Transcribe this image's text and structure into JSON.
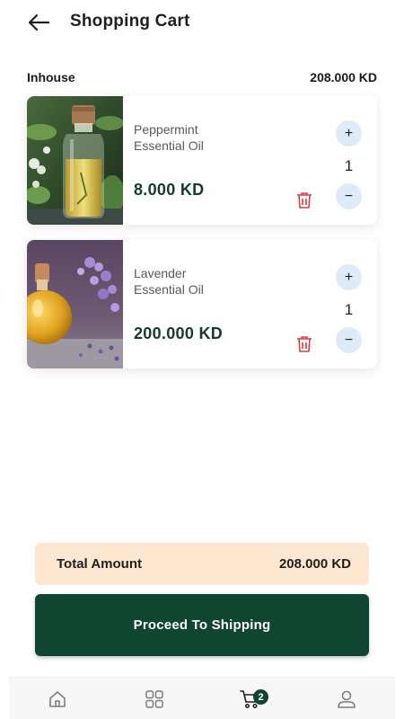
{
  "header": {
    "title": "Shopping Cart",
    "back_icon": "arrow-left-icon"
  },
  "section": {
    "label": "Inhouse",
    "total": "208.000 KD"
  },
  "items": [
    {
      "name_line1": "Peppermint",
      "name_line2": "Essential Oil",
      "price": "8.000 KD",
      "quantity": "1",
      "plus": "+",
      "minus": "−",
      "image": "peppermint-oil-bottle"
    },
    {
      "name_line1": "Lavender",
      "name_line2": "Essential Oil",
      "price": "200.000 KD",
      "quantity": "1",
      "plus": "+",
      "minus": "−",
      "image": "lavender-oil-flask"
    }
  ],
  "summary": {
    "label": "Total Amount",
    "value": "208.000 KD"
  },
  "proceed": {
    "label": "Proceed To Shipping"
  },
  "nav": {
    "items": [
      {
        "icon": "home-icon"
      },
      {
        "icon": "grid-icon"
      },
      {
        "icon": "cart-icon",
        "badge": "2"
      },
      {
        "icon": "user-icon"
      }
    ]
  },
  "colors": {
    "primary": "#0f4531",
    "price": "#173a2a",
    "total_bg": "#fde7d0",
    "qty_btn_bg": "#dcebf7",
    "delete": "#d83a3a"
  }
}
